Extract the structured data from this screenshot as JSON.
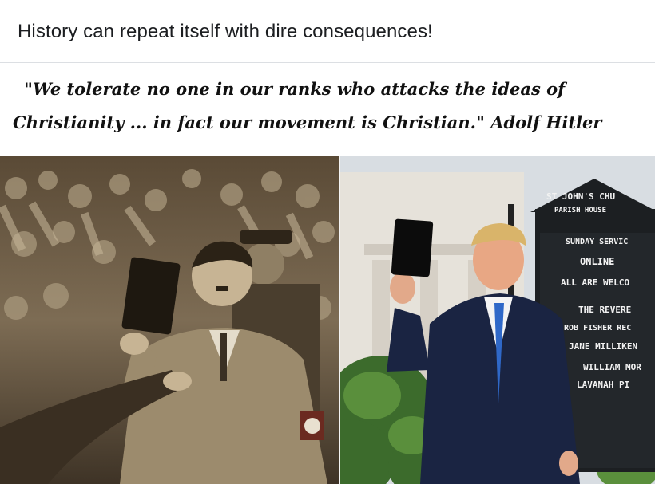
{
  "post": {
    "text": "History can repeat itself with dire consequences!"
  },
  "meme": {
    "quote_line1": "\"We tolerate no one in our ranks who attacks the ideas of",
    "quote_line2": "Christianity ... in fact our movement is Christian.\" Adolf Hitler",
    "sign_lines": [
      "ST JOHN'S CHU",
      "PARISH HOUSE",
      "SUNDAY SERVIC",
      "ONLINE",
      "ALL ARE WELCO",
      "THE REVERE",
      "ROB FISHER  REC",
      "JANE MILLIKEN",
      "WILLIAM  MOR",
      "LAVANAH  PI"
    ]
  },
  "colors": {
    "online_dot": "#31a24c",
    "text": "#1c1e21",
    "sepia": "#8a7a60",
    "sky": "#d8dde2",
    "suit": "#1a2442",
    "sign_bg": "#1c1f22"
  }
}
